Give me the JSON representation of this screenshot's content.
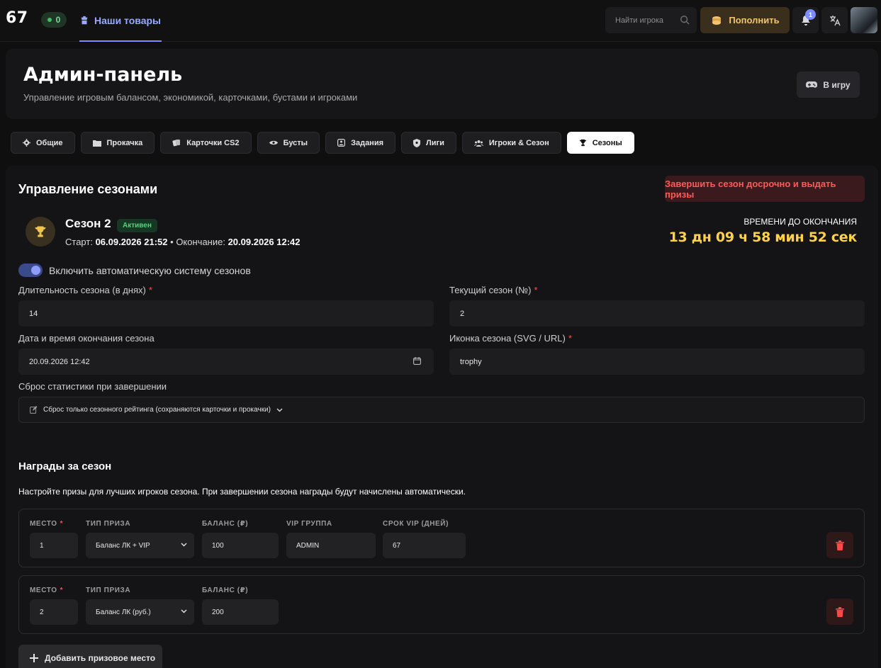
{
  "topbar": {
    "logo": "67",
    "online_count": "0",
    "nav_goods": "Наши товары",
    "search_placeholder": "Найти игрока",
    "topup_label": "Пополнить",
    "notifications_count": "1"
  },
  "header": {
    "title": "Админ-панель",
    "subtitle": "Управление игровым балансом, экономикой, карточками, бустами и игроками",
    "to_game_label": "В игру"
  },
  "tabs": [
    {
      "label": "Общие",
      "icon": "gear-icon",
      "active": false
    },
    {
      "label": "Прокачка",
      "icon": "folder-icon",
      "active": false
    },
    {
      "label": "Карточки CS2",
      "icon": "cards-icon",
      "active": false
    },
    {
      "label": "Бусты",
      "icon": "eye-icon",
      "active": false
    },
    {
      "label": "Задания",
      "icon": "task-icon",
      "active": false
    },
    {
      "label": "Лиги",
      "icon": "shield-icon",
      "active": false
    },
    {
      "label": "Игроки & Сезон",
      "icon": "users-icon",
      "active": false
    },
    {
      "label": "Сезоны",
      "icon": "trophy-icon",
      "active": true
    }
  ],
  "seasons": {
    "section_title": "Управление сезонами",
    "end_season_label": "Завершить сезон досрочно и выдать призы",
    "season_name": "Сезон 2",
    "status": "Активен",
    "start_prefix": "Старт:",
    "start_value": "06.09.2026 21:52",
    "separator": "•",
    "end_prefix": "Окончание:",
    "end_value": "20.09.2026 12:42",
    "countdown_label": "ВРЕМЕНИ ДО ОКОНЧАНИЯ",
    "countdown_value": "13 дн 09 ч 58 мин 52 сек",
    "auto_toggle_label": "Включить автоматическую систему сезонов",
    "auto_toggle_on": true,
    "duration_label": "Длительность сезона (в днях)",
    "duration_value": "14",
    "current_season_label": "Текущий сезон (№)",
    "current_season_value": "2",
    "end_datetime_label": "Дата и время окончания сезона",
    "end_datetime_value": "20.09.2026 12:42",
    "icon_label": "Иконка сезона (SVG / URL)",
    "icon_value": "trophy",
    "reset_label": "Сброс статистики при завершении",
    "reset_value": "Сброс только сезонного рейтинга (сохраняются карточки и прокачки)",
    "required_mark": "*"
  },
  "rewards": {
    "title": "Награды за сезон",
    "description": "Настройте призы для лучших игроков сезона. При завершении сезона награды будут начислены автоматически.",
    "columns": {
      "place": "МЕСТО",
      "prize_type": "ТИП ПРИЗА",
      "balance": "БАЛАНС (₽)",
      "vip_group": "VIP ГРУППА",
      "vip_days": "СРОК VIP (ДНЕЙ)"
    },
    "rows": [
      {
        "place": "1",
        "prize_type": "Баланс ЛК + VIP",
        "balance": "100",
        "vip_group": "ADMIN",
        "vip_days": "67"
      },
      {
        "place": "2",
        "prize_type": "Баланс ЛК (руб.)",
        "balance": "200"
      }
    ],
    "add_label": "Добавить призовое место"
  },
  "colors": {
    "accent": "#7c8cff",
    "gold": "#ffd24a",
    "danger": "#ff5a5a",
    "success": "#52d37f"
  }
}
